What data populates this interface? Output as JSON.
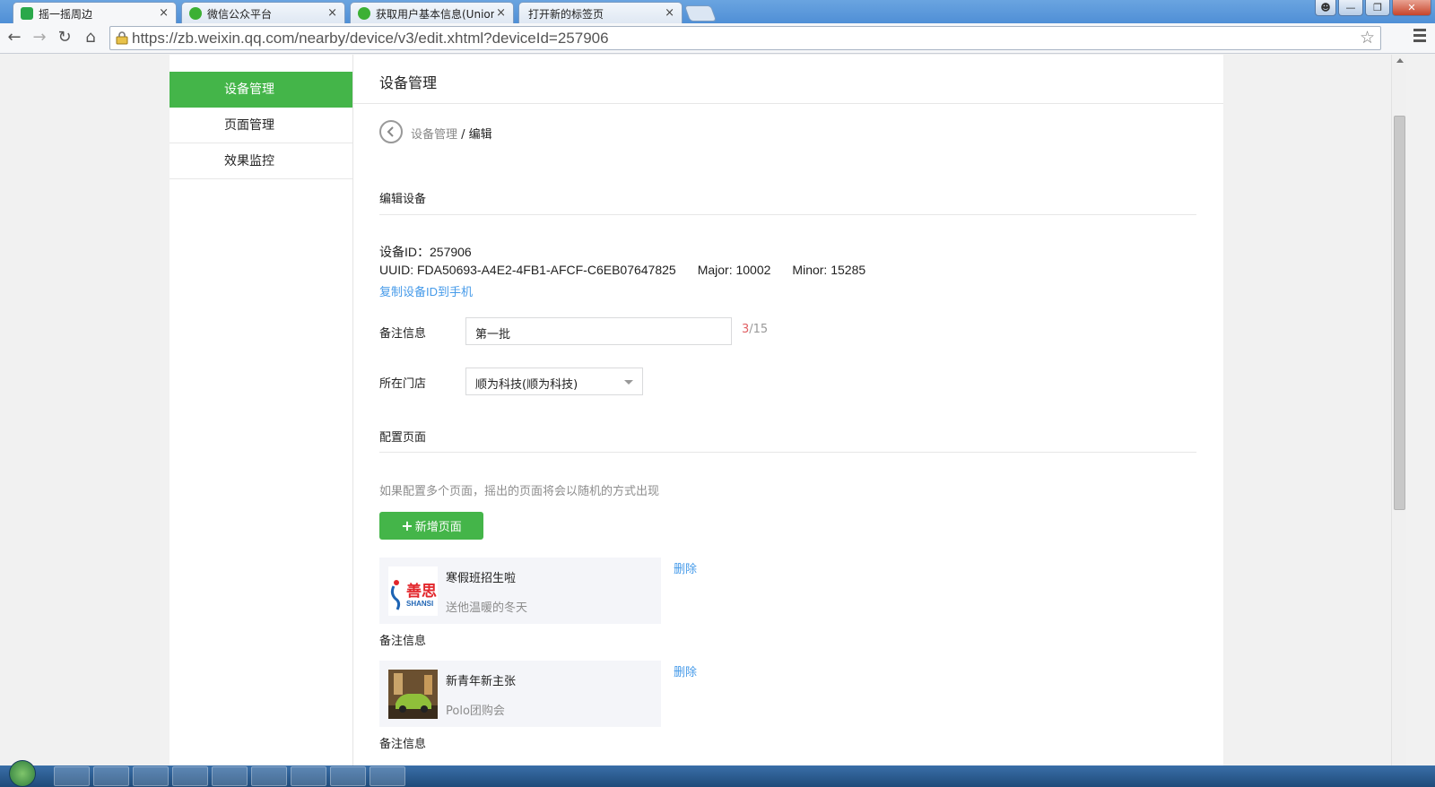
{
  "browser": {
    "tabs": [
      {
        "title": "摇一摇周边",
        "close": "×"
      },
      {
        "title": "微信公众平台",
        "close": "×"
      },
      {
        "title": "获取用户基本信息(UnionI",
        "close": "×"
      },
      {
        "title": "打开新的标签页",
        "close": "×"
      }
    ],
    "url": "https://zb.weixin.qq.com/nearby/device/v3/edit.xhtml?deviceId=257906"
  },
  "sidebar": {
    "items": [
      {
        "label": "设备管理"
      },
      {
        "label": "页面管理"
      },
      {
        "label": "效果监控"
      }
    ]
  },
  "main": {
    "title": "设备管理",
    "breadcrumb": {
      "parent": "设备管理",
      "sep": " / ",
      "current": "编辑"
    },
    "edit_section_title": "编辑设备",
    "device_id_line": "设备ID：257906",
    "uuid": "UUID: FDA50693-A4E2-4FB1-AFCF-C6EB07647825",
    "major": "Major: 10002",
    "minor": "Minor: 15285",
    "copy_link": "复制设备ID到手机",
    "remark_label": "备注信息",
    "remark_value": "第一批",
    "remark_count_used": "3",
    "remark_count_max": "/15",
    "store_label": "所在门店",
    "store_value": "顺为科技(顺为科技)",
    "config_section_title": "配置页面",
    "config_hint": "如果配置多个页面，摇出的页面将会以随机的方式出现",
    "add_page_button": "新增页面",
    "pages": [
      {
        "title": "寒假班招生啦",
        "desc": "送他温暖的冬天",
        "delete": "删除",
        "remark_label": "备注信息",
        "thumb_text": "善思",
        "thumb_sub": "SHANSI"
      },
      {
        "title": "新青年新主张",
        "desc": "Polo团购会",
        "delete": "删除",
        "remark_label": "备注信息"
      }
    ]
  },
  "colors": {
    "brand_green": "#44b549",
    "link_blue": "#459ae9",
    "counter_red": "#e15f63"
  }
}
